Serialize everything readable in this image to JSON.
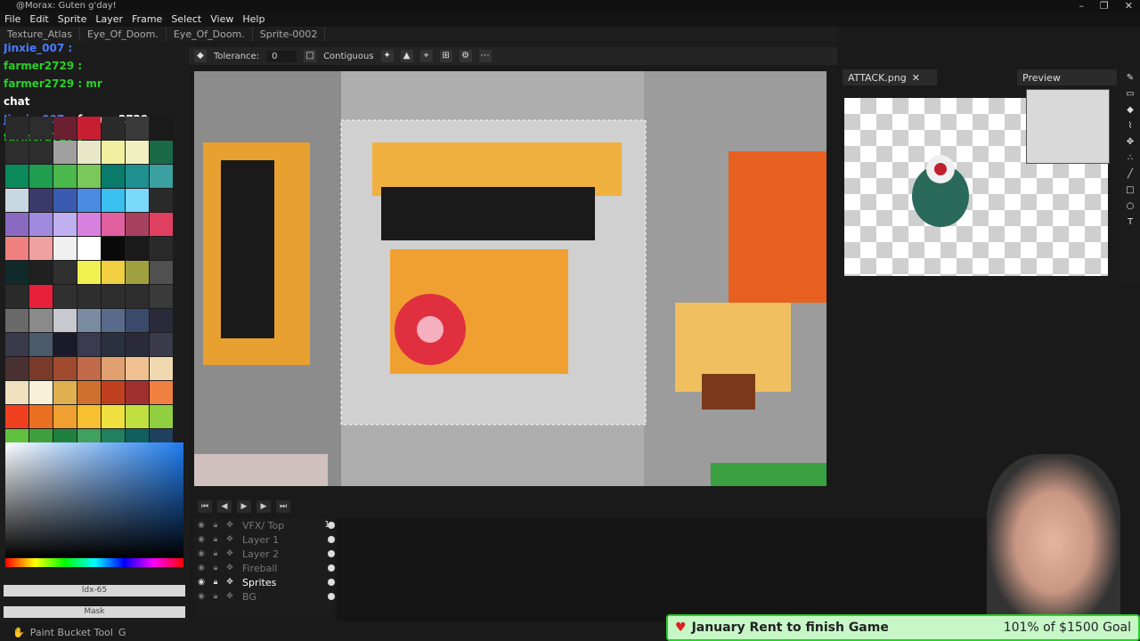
{
  "window": {
    "title": "@Morax: Guten g'day!",
    "buttons": [
      "–",
      "❐",
      "✕"
    ]
  },
  "menu": [
    "File",
    "Edit",
    "Sprite",
    "Layer",
    "Frame",
    "Select",
    "View",
    "Help"
  ],
  "tabs": [
    "Texture_Atlas",
    "Eye_Of_Doom.",
    "Eye_Of_Doom.",
    "Sprite-0002"
  ],
  "tool_options": {
    "tolerance_label": "Tolerance:",
    "tolerance_value": "0",
    "contiguous_label": "Contiguous"
  },
  "chat": [
    {
      "user": "Jinxie_007 :",
      "msg": "",
      "color": "#4b7bff"
    },
    {
      "user": "farmer2729 :",
      "msg": "",
      "color": "#27d027"
    },
    {
      "user": "farmer2729 : mr",
      "msg": "",
      "color": "#27d027"
    },
    {
      "user": "chat",
      "msg": "",
      "color": "#ffffff"
    },
    {
      "user": "Jinxie_007 :",
      "msg": "farmer2729",
      "color": "#4b7bff"
    },
    {
      "user": "farmer2729 :",
      "msg": "",
      "color": "#27d027"
    }
  ],
  "palette": [
    "#2a2a2a",
    "#2d2d2d",
    "#6a2030",
    "#c81e32",
    "#2b2b2b",
    "#3a3a3a",
    "#1a1a1a",
    "#2d2d2d",
    "#2d2d2d",
    "#a0a0a0",
    "#e8e8c8",
    "#f0f0a0",
    "#f0f0c0",
    "#1a6a4a",
    "#0a8a5a",
    "#1e9e4e",
    "#4ab84a",
    "#7ac85a",
    "#0a7a6a",
    "#1f8f8f",
    "#3aa0a0",
    "#c8d8e0",
    "#3a3a6a",
    "#3a5ab0",
    "#4a8ae0",
    "#3ac0f0",
    "#7ad8f8",
    "#2a2a2a",
    "#8a6ac0",
    "#a08ae0",
    "#c0b0f0",
    "#d880e0",
    "#e060a0",
    "#a84060",
    "#e04060",
    "#f08080",
    "#f0a0a0",
    "#f0f0f0",
    "#ffffff",
    "#0a0a0a",
    "#1a1a1a",
    "#2a2a2a",
    "#102a2a",
    "#202020",
    "#303030",
    "#f0f050",
    "#f0d040",
    "#a0a040",
    "#505050",
    "#2a2a2a",
    "#e8203a",
    "#303030",
    "#2e2e2e",
    "#2e2e2e",
    "#2e2e2e",
    "#3a3a3a",
    "#6a6a6a",
    "#8a8a8a",
    "#c8c8d0",
    "#7a8aa0",
    "#5a6a8a",
    "#3a4a6a",
    "#2a2a3a",
    "#3a3a4a",
    "#4a5a6a",
    "#1a1a2a",
    "#3a3a50",
    "#2a3040",
    "#2a2a3a",
    "#3a3a4a",
    "#4a3030",
    "#7a3a2a",
    "#a04a30",
    "#c06a4a",
    "#e0a070",
    "#f0c090",
    "#f0d8b0",
    "#f0e0c0",
    "#f8f0d8",
    "#e0b050",
    "#d07030",
    "#c04020",
    "#a03030",
    "#f08040",
    "#f04020",
    "#e87020",
    "#f0a030",
    "#f8c030",
    "#f0e040",
    "#c0e040",
    "#90d040",
    "#60c040",
    "#40a040",
    "#208040",
    "#40a060",
    "#208060",
    "#106060",
    "#204060"
  ],
  "color_fields": {
    "hex": "ldx-65",
    "mask": "Mask"
  },
  "attack_tab": "ATTACK.png",
  "preview_label": "Preview",
  "timeline": {
    "frame_number": "1",
    "layers": [
      {
        "name": "VFX/ Top",
        "active": false
      },
      {
        "name": "Layer 1",
        "active": false
      },
      {
        "name": "Layer 2",
        "active": false
      },
      {
        "name": "Fireball",
        "active": false
      },
      {
        "name": "Sprites",
        "active": true
      },
      {
        "name": "BG",
        "active": false
      }
    ]
  },
  "status": {
    "tool": "Paint Bucket Tool",
    "shortcut": "G"
  },
  "goal": {
    "title": "January Rent to finish Game",
    "amount": "101% of $1500 Goal"
  }
}
